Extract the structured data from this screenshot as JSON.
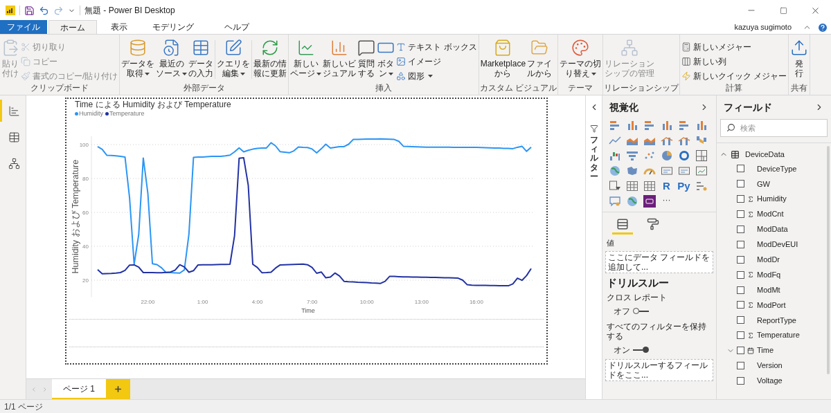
{
  "window": {
    "title": "無題 - Power BI Desktop"
  },
  "menu_tabs": [
    {
      "label": "ファイル",
      "kind": "file",
      "selected": false
    },
    {
      "label": "ホーム",
      "kind": "tab",
      "selected": true
    },
    {
      "label": "表示",
      "kind": "tab",
      "selected": false
    },
    {
      "label": "モデリング",
      "kind": "tab",
      "selected": false
    },
    {
      "label": "ヘルプ",
      "kind": "tab",
      "selected": false
    }
  ],
  "user": "kazuya sugimoto",
  "ribbon": [
    {
      "label": "クリップボード",
      "items": [
        {
          "kind": "large",
          "lines": [
            "貼り",
            "付け"
          ],
          "dropdown": false,
          "disabled": true
        },
        {
          "kind": "stack",
          "entries": [
            {
              "label": "切り取り",
              "dropdown": false,
              "disabled": true
            },
            {
              "label": "コピー",
              "dropdown": false,
              "disabled": true
            },
            {
              "label": "書式のコピー/貼り付け",
              "dropdown": false,
              "disabled": true
            }
          ]
        }
      ]
    },
    {
      "label": "外部データ",
      "items": [
        {
          "kind": "large",
          "lines": [
            "データを",
            "取得"
          ],
          "dropdown": true,
          "disabled": false
        },
        {
          "kind": "large",
          "lines": [
            "最近の",
            "ソース"
          ],
          "dropdown": true,
          "disabled": false
        },
        {
          "kind": "large",
          "lines": [
            "データ",
            "の入力"
          ],
          "dropdown": false,
          "disabled": false
        },
        {
          "kind": "separator"
        },
        {
          "kind": "large",
          "lines": [
            "クエリを",
            "編集"
          ],
          "dropdown": true,
          "disabled": false
        },
        {
          "kind": "separator"
        },
        {
          "kind": "large",
          "lines": [
            "最新の情",
            "報に更新"
          ],
          "dropdown": false,
          "disabled": false
        }
      ]
    },
    {
      "label": "挿入",
      "items": [
        {
          "kind": "large",
          "lines": [
            "新しい",
            "ページ"
          ],
          "dropdown": true,
          "disabled": false
        },
        {
          "kind": "large",
          "lines": [
            "新しいビ",
            "ジュアル"
          ],
          "dropdown": false,
          "disabled": false
        },
        {
          "kind": "large",
          "lines": [
            "質問",
            "する"
          ],
          "dropdown": false,
          "disabled": false
        },
        {
          "kind": "large",
          "lines": [
            "ボタ",
            "ン"
          ],
          "dropdown": true,
          "disabled": false
        },
        {
          "kind": "stack",
          "entries": [
            {
              "label": "テキスト ボックス",
              "dropdown": false,
              "disabled": false
            },
            {
              "label": "イメージ",
              "dropdown": false,
              "disabled": false
            },
            {
              "label": "図形",
              "dropdown": true,
              "disabled": false
            }
          ]
        }
      ]
    },
    {
      "label": "カスタム ビジュアル",
      "items": [
        {
          "kind": "large",
          "lines": [
            "Marketplace",
            "から"
          ],
          "dropdown": false,
          "disabled": false
        },
        {
          "kind": "large",
          "lines": [
            "ファイ",
            "ルから"
          ],
          "dropdown": false,
          "disabled": false
        }
      ]
    },
    {
      "label": "テーマ",
      "items": [
        {
          "kind": "large",
          "lines": [
            "テーマの切",
            "り替え"
          ],
          "dropdown": true,
          "disabled": false
        }
      ]
    },
    {
      "label": "リレーションシップ",
      "items": [
        {
          "kind": "large",
          "lines": [
            "リレーション",
            "シップの管理"
          ],
          "dropdown": false,
          "disabled": true
        }
      ]
    },
    {
      "label": "計算",
      "items": [
        {
          "kind": "stack",
          "entries": [
            {
              "label": "新しいメジャー",
              "dropdown": false,
              "disabled": false
            },
            {
              "label": "新しい列",
              "dropdown": false,
              "disabled": false
            },
            {
              "label": "新しいクイック メジャー",
              "dropdown": false,
              "disabled": false
            }
          ]
        }
      ]
    },
    {
      "label": "共有",
      "items": [
        {
          "kind": "large",
          "lines": [
            "発",
            "行"
          ],
          "dropdown": false,
          "disabled": false
        }
      ]
    }
  ],
  "views": [
    {
      "selected": true
    },
    {
      "selected": false
    },
    {
      "selected": false
    }
  ],
  "chart": {
    "title": "Time による Humidity および Temperature",
    "chart_data": {
      "type": "line",
      "xlabel": "Time",
      "ylabel": "Humidity および Temperature",
      "grid": true,
      "legend": "top-left",
      "ylim": [
        10,
        105
      ],
      "categories": [
        null,
        null,
        null,
        null,
        null,
        null,
        null,
        null,
        null,
        null,
        null,
        "22:00",
        null,
        null,
        null,
        null,
        null,
        null,
        null,
        null,
        null,
        null,
        null,
        "1:00",
        null,
        null,
        null,
        null,
        null,
        null,
        null,
        null,
        null,
        null,
        null,
        "4:00",
        null,
        null,
        null,
        null,
        null,
        null,
        null,
        null,
        null,
        null,
        null,
        "7:00",
        null,
        null,
        null,
        null,
        null,
        null,
        null,
        null,
        null,
        null,
        null,
        "10:00",
        null,
        null,
        null,
        null,
        null,
        null,
        null,
        null,
        null,
        null,
        null,
        "13:00",
        null,
        null,
        null,
        null,
        null,
        null,
        null,
        null,
        null,
        null,
        null,
        "16:00",
        null,
        null,
        null,
        null,
        null,
        null,
        null,
        null,
        null,
        null,
        null,
        null
      ],
      "yticks": [
        20,
        40,
        60,
        80,
        100
      ],
      "series": [
        {
          "name": "Humidity",
          "color": "#2b95f5",
          "values": [
            98.8,
            97.2,
            93.7,
            93.6,
            93.4,
            93.1,
            92.7,
            68.6,
            29.4,
            46.9,
            92.1,
            71.3,
            29.7,
            29.2,
            27.3,
            24.5,
            24.5,
            24.3,
            24.2,
            26.1,
            47.1,
            92.4,
            92.6,
            92.7,
            92.9,
            93.0,
            93.0,
            93.1,
            93.4,
            93.8,
            95.7,
            98.1,
            95.7,
            96.6,
            97.3,
            97.8,
            98.0,
            98.0,
            101.1,
            99.2,
            95.8,
            95.5,
            95.2,
            96.3,
            98.6,
            98.4,
            98.3,
            97.4,
            95.1,
            97.5,
            100.2,
            97.9,
            98.4,
            98.8,
            98.8,
            100.2,
            103.0,
            103.1,
            103.2,
            103.3,
            103.3,
            103.3,
            103.4,
            103.3,
            103.2,
            103.0,
            101.9,
            99.0,
            98.9,
            98.8,
            98.7,
            98.6,
            98.5,
            98.5,
            98.5,
            98.5,
            98.5,
            98.5,
            98.4,
            98.4,
            98.4,
            98.4,
            98.4,
            98.4,
            98.3,
            98.2,
            98.1,
            98.0,
            97.9,
            97.8,
            97.7,
            97.6,
            98.4,
            99.0,
            96.0,
            98.5
          ]
        },
        {
          "name": "Temperature",
          "color": "#2232a3",
          "values": [
            26.2,
            23.8,
            23.9,
            24.0,
            24.2,
            24.5,
            25.8,
            28.9,
            29.0,
            27.7,
            24.5,
            24.5,
            24.5,
            24.4,
            24.4,
            24.6,
            24.8,
            26.0,
            29.1,
            27.8,
            24.7,
            25.6,
            29.0,
            29.1,
            29.1,
            29.1,
            29.2,
            29.3,
            29.3,
            29.4,
            46.3,
            91.9,
            92.2,
            76.0,
            29.4,
            27.5,
            24.4,
            24.5,
            24.7,
            27.2,
            29.0,
            29.1,
            29.2,
            29.3,
            29.4,
            29.5,
            29.1,
            27.5,
            24.1,
            24.8,
            21.4,
            21.8,
            24.2,
            22.5,
            19.3,
            19.1,
            19.0,
            18.8,
            18.7,
            18.6,
            18.4,
            18.3,
            18.1,
            19.3,
            22.3,
            22.2,
            22.1,
            21.9,
            21.9,
            21.8,
            21.8,
            21.7,
            21.7,
            21.6,
            21.6,
            21.5,
            21.4,
            21.4,
            21.3,
            21.2,
            20.0,
            17.3,
            17.0,
            16.9,
            16.9,
            16.9,
            16.8,
            16.8,
            16.7,
            16.7,
            16.7,
            17.8,
            21.2,
            19.9,
            22.7,
            26.8
          ]
        }
      ]
    }
  },
  "pages": [
    {
      "label": "ページ 1",
      "selected": true
    }
  ],
  "filters_label": "フィルター",
  "visualizations": {
    "title": "視覚化",
    "types": [
      {
        "kind": "bar"
      },
      {
        "kind": "column"
      },
      {
        "kind": "bar"
      },
      {
        "kind": "column"
      },
      {
        "kind": "bar"
      },
      {
        "kind": "column"
      },
      {
        "kind": "line"
      },
      {
        "kind": "area"
      },
      {
        "kind": "area"
      },
      {
        "kind": "combo"
      },
      {
        "kind": "combo"
      },
      {
        "kind": "ribbon"
      },
      {
        "kind": "waterfall"
      },
      {
        "kind": "funnel"
      },
      {
        "kind": "scatter"
      },
      {
        "kind": "pie"
      },
      {
        "kind": "donut"
      },
      {
        "kind": "treemap"
      },
      {
        "kind": "globe"
      },
      {
        "kind": "map"
      },
      {
        "kind": "gauge"
      },
      {
        "kind": "card"
      },
      {
        "kind": "card"
      },
      {
        "kind": "kpi"
      },
      {
        "kind": "slicer"
      },
      {
        "kind": "table"
      },
      {
        "kind": "table"
      },
      {
        "kind": "script",
        "label": "R"
      },
      {
        "kind": "script",
        "label": "Py"
      },
      {
        "kind": "influencers"
      },
      {
        "kind": "qna"
      },
      {
        "kind": "globe"
      },
      {
        "kind": "custom"
      }
    ],
    "more": "···",
    "pane_tabs": [
      {
        "selected": true
      },
      {
        "selected": false
      }
    ],
    "values_label": "値",
    "values_drop": "ここにデータ フィールドを追加して...",
    "drillthrough": {
      "title": "ドリルスルー",
      "cross_report": {
        "label": "クロス レポート",
        "state": "オフ",
        "on": false
      },
      "keep_filters": {
        "label": "すべてのフィルターを保持する",
        "state": "オン",
        "on": true
      },
      "drop": "ドリルスルーするフィールドをここ..."
    }
  },
  "fields": {
    "title": "フィールド",
    "search": {
      "placeholder": "検索"
    },
    "tables": [
      {
        "name": "DeviceData",
        "expanded": true,
        "fields": [
          {
            "name": "DeviceType",
            "kind": "plain",
            "checked": false
          },
          {
            "name": "GW",
            "kind": "plain",
            "checked": false
          },
          {
            "name": "Humidity",
            "kind": "sum",
            "checked": false
          },
          {
            "name": "ModCnt",
            "kind": "sum",
            "checked": false
          },
          {
            "name": "ModData",
            "kind": "plain",
            "checked": false
          },
          {
            "name": "ModDevEUI",
            "kind": "plain",
            "checked": false
          },
          {
            "name": "ModDr",
            "kind": "plain",
            "checked": false
          },
          {
            "name": "ModFq",
            "kind": "sum",
            "checked": false
          },
          {
            "name": "ModMt",
            "kind": "plain",
            "checked": false
          },
          {
            "name": "ModPort",
            "kind": "sum",
            "checked": false
          },
          {
            "name": "ReportType",
            "kind": "plain",
            "checked": false
          },
          {
            "name": "Temperature",
            "kind": "sum",
            "checked": false
          },
          {
            "name": "Time",
            "kind": "date",
            "checked": false,
            "expanded": false
          },
          {
            "name": "Version",
            "kind": "plain",
            "checked": false
          },
          {
            "name": "Voltage",
            "kind": "plain",
            "checked": false
          }
        ]
      }
    ]
  },
  "status_bar": {
    "page": "1/1 ページ"
  }
}
